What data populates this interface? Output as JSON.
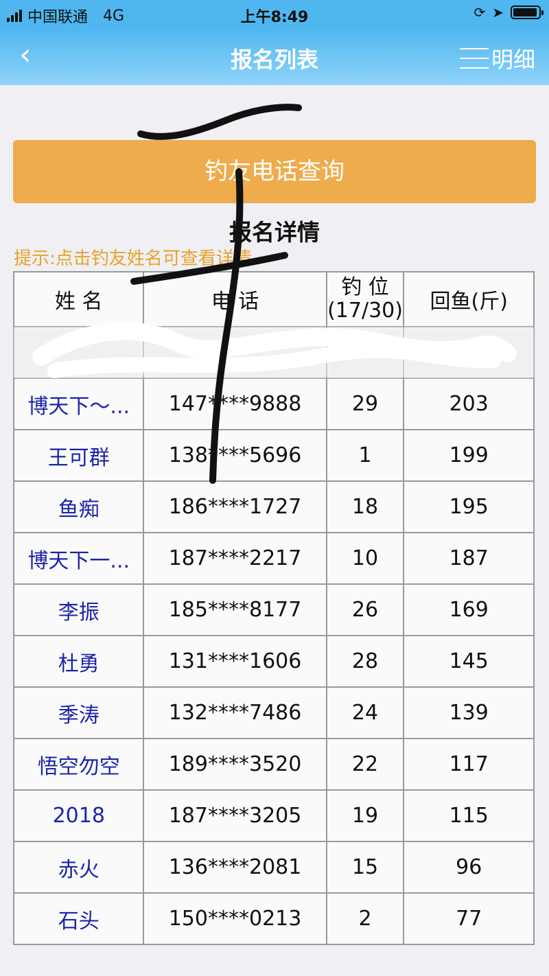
{
  "status_bar": {
    "carrier": "中国联通",
    "network": "4G",
    "time": "上午8:49"
  },
  "nav": {
    "back_icon": "‹",
    "title": "报名列表",
    "detail_label": "明细"
  },
  "query_button_label": "钓友电话查询",
  "section_title": "报名详情",
  "hint": "提示:点击钓友姓名可查看详情",
  "table": {
    "headers": {
      "name": "姓 名",
      "phone": "电 话",
      "seat_line1": "钓 位",
      "seat_line2": "(17/30)",
      "fish": "回鱼(斤)"
    },
    "rows": [
      {
        "name": "博天下～...",
        "phone": "147****9888",
        "seat": "29",
        "fish": "203"
      },
      {
        "name": "王可群",
        "phone": "138****5696",
        "seat": "1",
        "fish": "199"
      },
      {
        "name": "鱼痴",
        "phone": "186****1727",
        "seat": "18",
        "fish": "195"
      },
      {
        "name": "博天下一...",
        "phone": "187****2217",
        "seat": "10",
        "fish": "187"
      },
      {
        "name": "李振",
        "phone": "185****8177",
        "seat": "26",
        "fish": "169"
      },
      {
        "name": "杜勇",
        "phone": "131****1606",
        "seat": "28",
        "fish": "145"
      },
      {
        "name": "季涛",
        "phone": "132****7486",
        "seat": "24",
        "fish": "139"
      },
      {
        "name": "悟空勿空",
        "phone": "189****3520",
        "seat": "22",
        "fish": "117"
      },
      {
        "name": "2018",
        "phone": "187****3205",
        "seat": "19",
        "fish": "115"
      },
      {
        "name": "赤火",
        "phone": "136****2081",
        "seat": "15",
        "fish": "96"
      },
      {
        "name": "石头",
        "phone": "150****0213",
        "seat": "2",
        "fish": "77"
      }
    ]
  }
}
